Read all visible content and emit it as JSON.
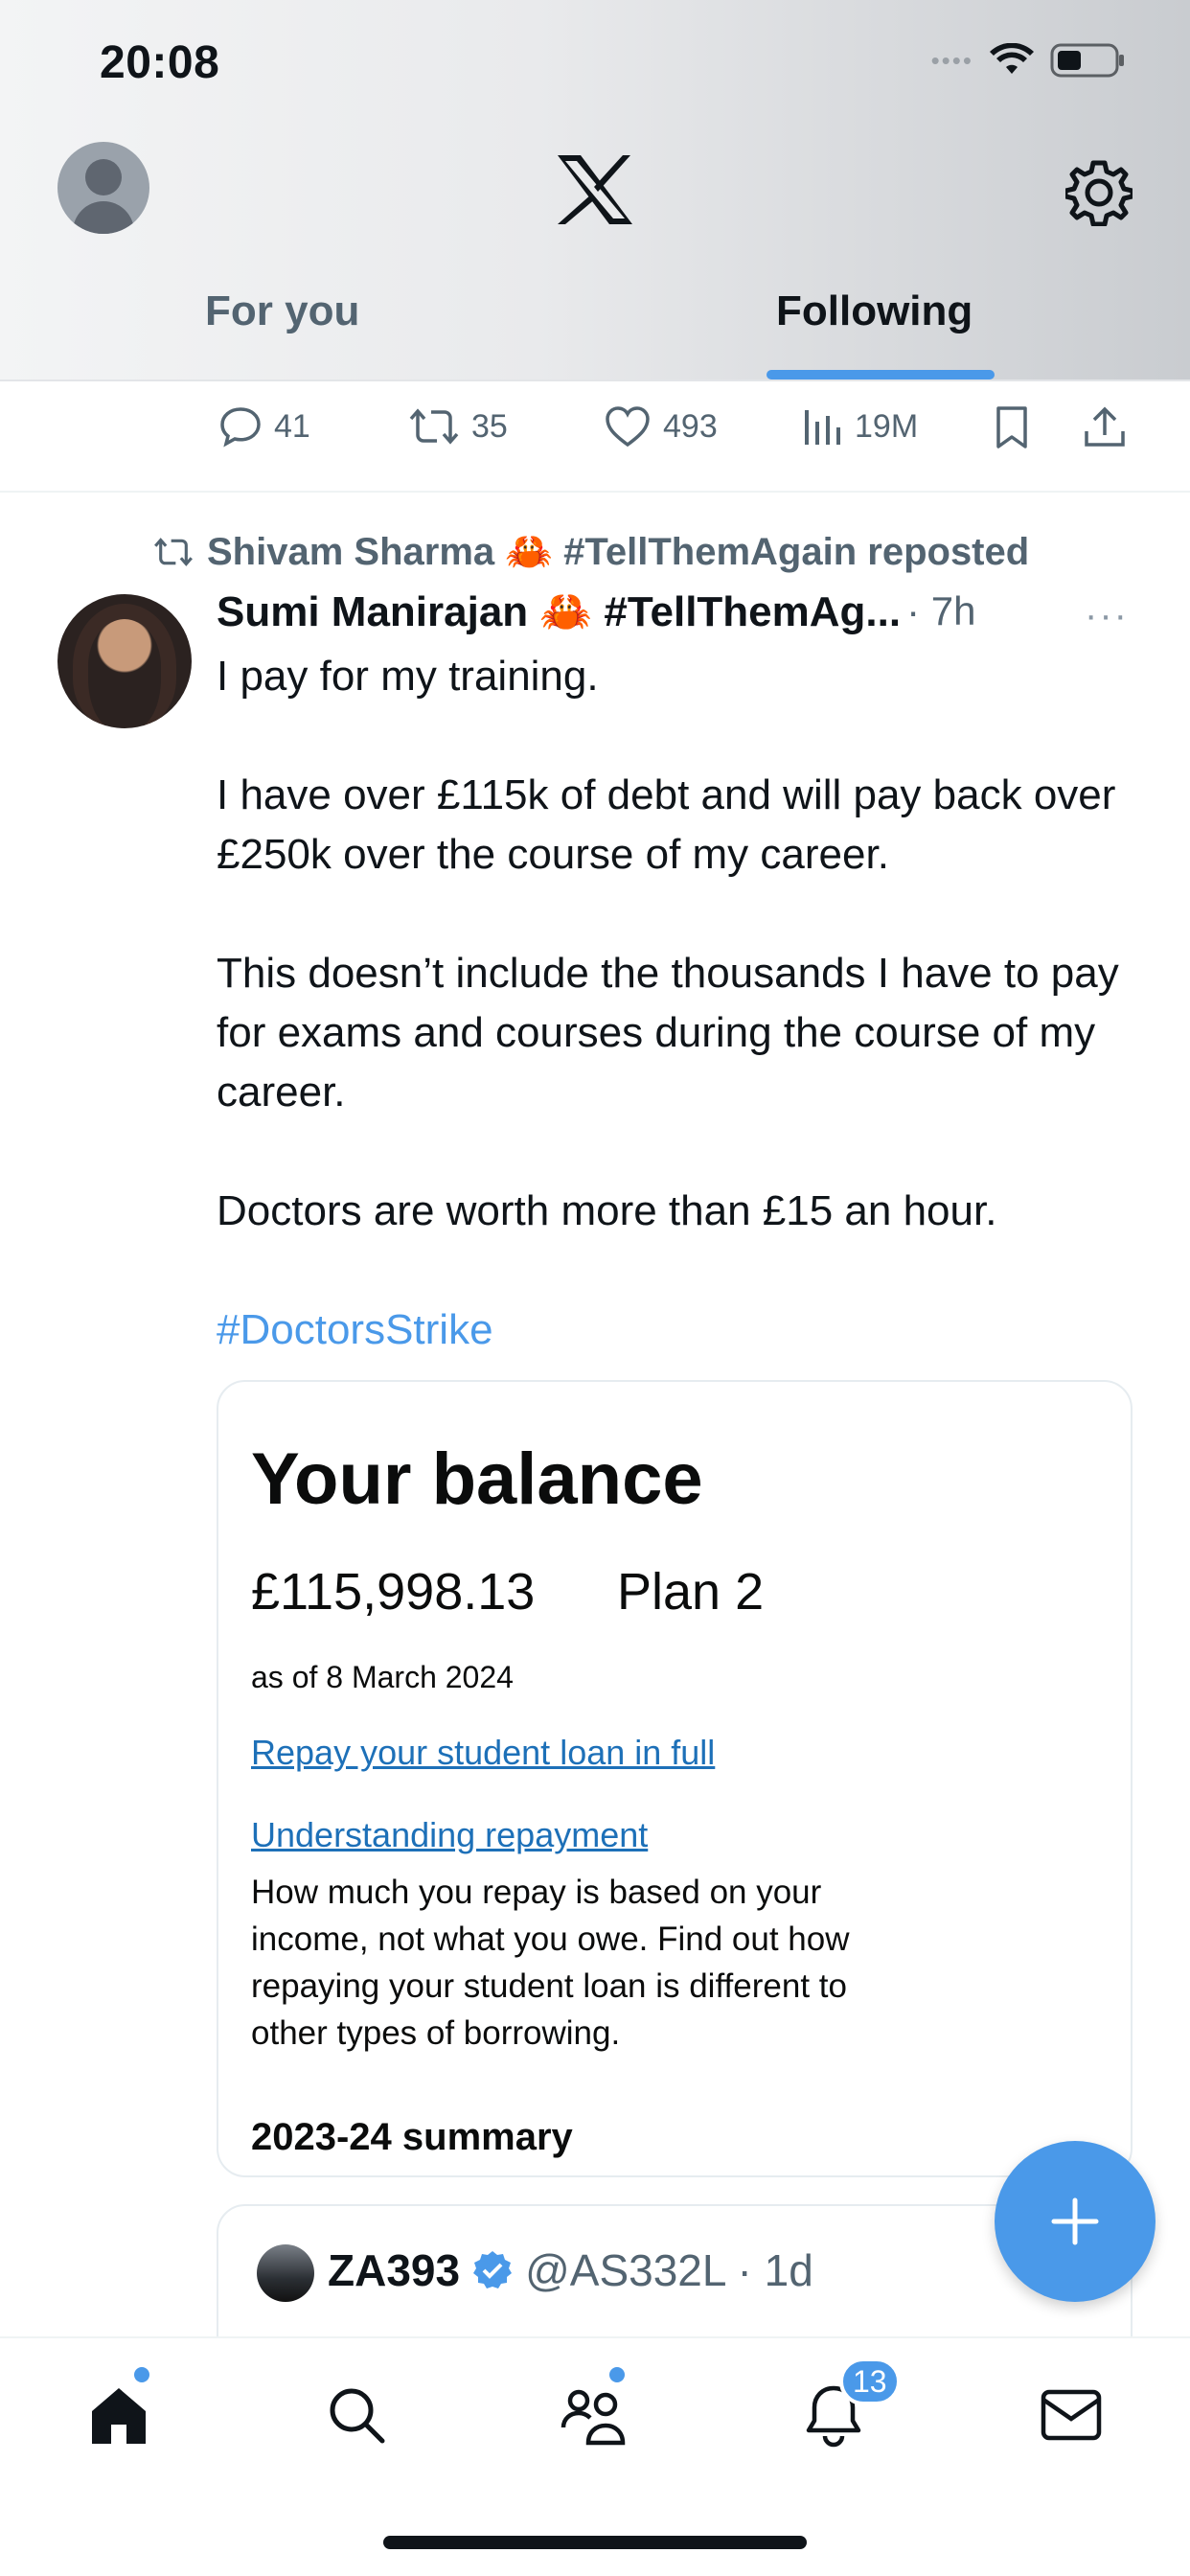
{
  "status_bar": {
    "time": "20:08"
  },
  "header": {
    "tabs": [
      {
        "label": "For you",
        "active": false
      },
      {
        "label": "Following",
        "active": true
      }
    ]
  },
  "prev_tweet_actions": {
    "replies": "41",
    "reposts": "35",
    "likes": "493",
    "views": "19M"
  },
  "tweet": {
    "repost_by": "Shivam Sharma 🦀 #TellThemAgain reposted",
    "author_name": "Sumi Manirajan 🦀 #TellThemAg...",
    "time": "· 7h",
    "more_label": "···",
    "paragraphs": [
      "I pay for my training.",
      "I have over £115k of debt and will pay back over £250k over the course of my career.",
      "This doesn’t include the thousands I have to pay for exams and courses during the course of my career.",
      "Doctors are worth more than £15 an hour."
    ],
    "hashtag": "#DoctorsStrike",
    "image_card": {
      "title": "Your balance",
      "amount": "£115,998.13",
      "plan": "Plan 2",
      "as_of": "as of 8 March 2024",
      "link_repay": "Repay your student loan in full",
      "link_understanding": "Understanding repayment",
      "description": "How much you repay is based on your income, not what you owe. Find out how repaying your student loan is different to other types of borrowing.",
      "summary_heading": "2023-24 summary"
    },
    "quoted": {
      "name": "ZA393",
      "handle": "@AS332L · 1d"
    }
  },
  "bottom_nav": {
    "notifications_badge": "13"
  },
  "colors": {
    "accent": "#4a99e9",
    "text_primary": "#0f1419",
    "text_secondary": "#536471",
    "gov_link": "#1d70b8"
  }
}
